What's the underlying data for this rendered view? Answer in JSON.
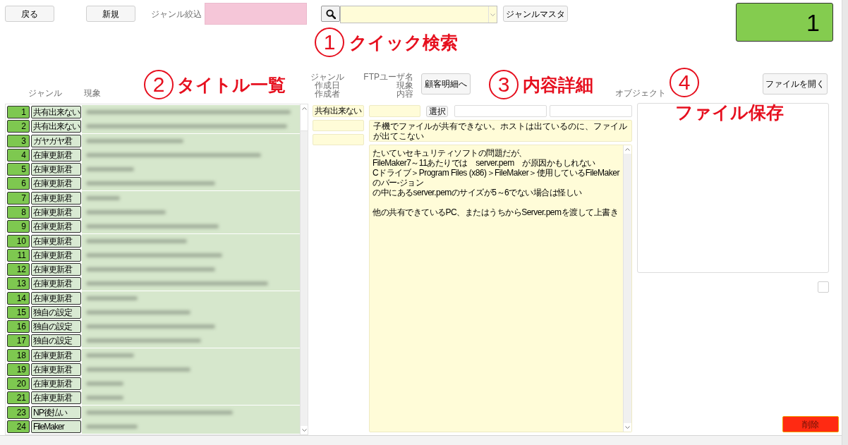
{
  "toolbar": {
    "buttons": [
      "戻る",
      "新規"
    ],
    "genre_filter_label": "ジャンル絞込",
    "genre_master_button": "ジャンルマスタ"
  },
  "record_number": "1",
  "annotations": [
    {
      "number": "1",
      "text": "クイック検索"
    },
    {
      "number": "2",
      "text": "タイトル一覧"
    },
    {
      "number": "3",
      "text": "内容詳細"
    },
    {
      "number": "4",
      "text": "ファイル保存"
    }
  ],
  "list": {
    "columns": [
      "ジャンル",
      "現象"
    ],
    "rows": [
      {
        "number": "1",
        "genre": "共有出来ない"
      },
      {
        "number": "2",
        "genre": "共有出来ない"
      },
      {
        "number": "3",
        "genre": "ガヤガヤ君"
      },
      {
        "number": "4",
        "genre": "在庫更新君"
      },
      {
        "number": "5",
        "genre": "在庫更新君"
      },
      {
        "number": "6",
        "genre": "在庫更新君"
      },
      {
        "number": "7",
        "genre": "在庫更新君"
      },
      {
        "number": "8",
        "genre": "在庫更新君"
      },
      {
        "number": "9",
        "genre": "在庫更新君"
      },
      {
        "number": "10",
        "genre": "在庫更新君"
      },
      {
        "number": "11",
        "genre": "在庫更新君"
      },
      {
        "number": "12",
        "genre": "在庫更新君"
      },
      {
        "number": "13",
        "genre": "在庫更新君"
      },
      {
        "number": "14",
        "genre": "在庫更新君"
      },
      {
        "number": "15",
        "genre": "独自の設定"
      },
      {
        "number": "16",
        "genre": "独自の設定"
      },
      {
        "number": "17",
        "genre": "独自の設定"
      },
      {
        "number": "18",
        "genre": "在庫更新君"
      },
      {
        "number": "19",
        "genre": "在庫更新君"
      },
      {
        "number": "20",
        "genre": "在庫更新君"
      },
      {
        "number": "21",
        "genre": "在庫更新君"
      },
      {
        "number": "23",
        "genre": "NP後払い"
      },
      {
        "number": "24",
        "genre": "FileMaker"
      }
    ]
  },
  "detail": {
    "field_labels_1": [
      "ジャンル",
      "作成日",
      "作成者"
    ],
    "field_labels_2": [
      "FTPユーザ名",
      "現象",
      "内容"
    ],
    "customer_button": "顧客明細へ",
    "genre": "共有出来ない",
    "select_button": "選択",
    "symptom": "子機でファイルが共有できない。ホストは出ているのに、ファイルが出てこない",
    "content": {
      "paragraphs": [
        [
          "たいていセキュリティソフトの問題だが、",
          "FileMaker7～11あたりでは　server.pem　が原因かもしれない",
          "Cドライブ＞Program Files (x86)＞FileMaker＞使用しているFileMakerのバー-ジョン",
          "の中にあるserver.pemのサイズが5～6でない場合は怪しい"
        ],
        [
          "他の共有できているPC、またはうちからServer.pemを渡して上書き"
        ]
      ]
    }
  },
  "object_panel": {
    "label": "オブジェクト",
    "open_button": "ファイルを開く",
    "checkbox": {
      "checked": false
    }
  },
  "delete_button": "削除"
}
